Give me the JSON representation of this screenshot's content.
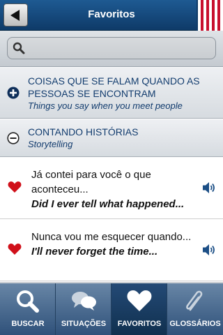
{
  "header": {
    "title": "Favoritos",
    "back_icon": "back-arrow-icon",
    "flag": "flag-stripes"
  },
  "search": {
    "placeholder": "",
    "icon": "search-icon"
  },
  "categories": [
    {
      "title": "COISAS QUE SE FALAM QUANDO AS PESSOAS SE ENCONTRAM",
      "subtitle": "Things you say when you meet people",
      "icon": "plus-circle-icon",
      "expanded": false
    },
    {
      "title": "CONTANDO HISTÓRIAS",
      "subtitle": "Storytelling",
      "icon": "minus-circle-icon",
      "expanded": true
    }
  ],
  "phrases": [
    {
      "portuguese": "Já contei para você o que aconteceu...",
      "english": "Did I ever tell what happened...",
      "favorite_icon": "heart-icon",
      "audio_icon": "speaker-icon"
    },
    {
      "portuguese": "Nunca vou me esquecer quando...",
      "english": "I'll never forget the time...",
      "favorite_icon": "heart-icon",
      "audio_icon": "speaker-icon"
    }
  ],
  "tabs": [
    {
      "label": "BUSCAR",
      "icon": "search-icon",
      "active": false
    },
    {
      "label": "SITUAÇÕES",
      "icon": "chat-bubbles-icon",
      "active": false
    },
    {
      "label": "FAVORITOS",
      "icon": "heart-icon",
      "active": true
    },
    {
      "label": "GLOSSÁRIOS",
      "icon": "paperclip-icon",
      "active": false
    }
  ],
  "colors": {
    "header_blue": "#1e5a92",
    "accent_navy": "#123c6e",
    "heart_red": "#d0101a",
    "tab_bar": "#4a6a90"
  }
}
